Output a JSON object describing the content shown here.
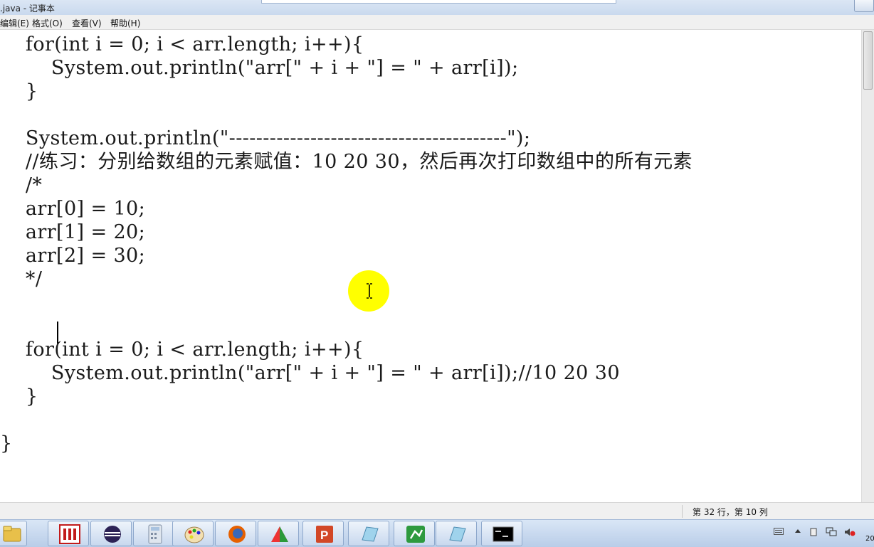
{
  "window": {
    "title": ".java - 记事本"
  },
  "menu": [
    {
      "label": "编辑(E)"
    },
    {
      "label": "格式(O)"
    },
    {
      "label": "查看(V)"
    },
    {
      "label": "帮助(H)"
    }
  ],
  "editor": {
    "lines": [
      "    for(int i = 0; i < arr.length; i++){",
      "        System.out.println(\"arr[\" + i + \"] = \" + arr[i]);",
      "    }",
      "",
      "    System.out.println(\"-----------------------------------------\");",
      "    //练习：分别给数组的元素赋值：10 20 30，然后再次打印数组中的所有元素",
      "    /*",
      "    arr[0] = 10;",
      "    arr[1] = 20;",
      "    arr[2] = 30;",
      "    */",
      "",
      "",
      "    for(int i = 0; i < arr.length; i++){",
      "        System.out.println(\"arr[\" + i + \"] = \" + arr[i]);//10 20 30",
      "    }",
      "",
      "}"
    ]
  },
  "status": {
    "cursor_position": "第 32 行，第 10 列"
  },
  "taskbar": {
    "apps": [
      {
        "icon": "file-explorer-icon"
      },
      {
        "icon": "app-red-icon"
      },
      {
        "icon": "eclipse-icon"
      },
      {
        "icon": "calculator-icon"
      },
      {
        "icon": "paint-icon"
      },
      {
        "icon": "firefox-icon"
      },
      {
        "icon": "xmind-icon"
      },
      {
        "icon": "powerpoint-icon"
      },
      {
        "icon": "notepad-icon"
      },
      {
        "icon": "presenter-icon"
      },
      {
        "icon": "notepad-icon"
      },
      {
        "icon": "command-prompt-icon"
      }
    ],
    "clock_partial": "20"
  },
  "colors": {
    "mouse_highlight": "#ffff00",
    "taskbar": "#c8d8ee"
  }
}
